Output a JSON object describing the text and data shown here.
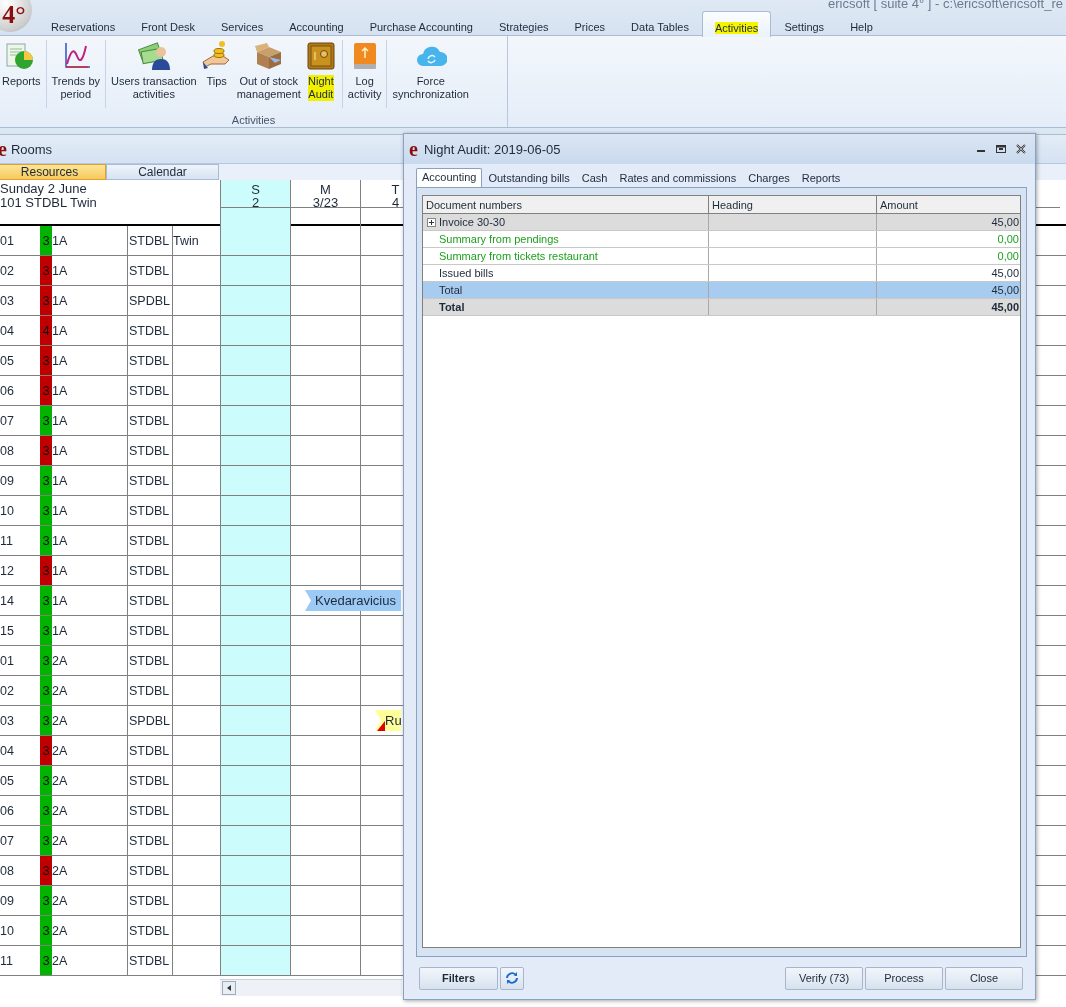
{
  "app": {
    "title": "ericsoft [ suite 4° ] - c:\\ericsoft\\ericsoft_re",
    "logo": "4°"
  },
  "menu": [
    {
      "label": "Reservations",
      "selected": false,
      "highlighted": false
    },
    {
      "label": "Front Desk",
      "selected": false,
      "highlighted": false
    },
    {
      "label": "Services",
      "selected": false,
      "highlighted": false
    },
    {
      "label": "Accounting",
      "selected": false,
      "highlighted": false
    },
    {
      "label": "Purchase Accounting",
      "selected": false,
      "highlighted": false
    },
    {
      "label": "Strategies",
      "selected": false,
      "highlighted": false
    },
    {
      "label": "Prices",
      "selected": false,
      "highlighted": false
    },
    {
      "label": "Data Tables",
      "selected": false,
      "highlighted": false
    },
    {
      "label": "Activities",
      "selected": true,
      "highlighted": true
    },
    {
      "label": "Settings",
      "selected": false,
      "highlighted": false
    },
    {
      "label": "Help",
      "selected": false,
      "highlighted": false
    }
  ],
  "ribbon": {
    "group_label": "Activities",
    "buttons": [
      {
        "label": "Reports",
        "highlighted": false
      },
      {
        "label": "Trends by\nperiod",
        "highlighted": false
      },
      {
        "label": "Users transaction\nactivities",
        "highlighted": false
      },
      {
        "label": "Tips",
        "highlighted": false
      },
      {
        "label": "Out of stock\nmanagement",
        "highlighted": false
      },
      {
        "label": "Night\nAudit",
        "highlighted": true
      },
      {
        "label": "Log\nactivity",
        "highlighted": false
      },
      {
        "label": "Force\nsynchronization",
        "highlighted": false
      }
    ]
  },
  "rooms": {
    "window_icon": "e",
    "title": "Rooms",
    "tabs": [
      {
        "label": "Resources",
        "selected": true
      },
      {
        "label": "Calendar",
        "selected": false
      }
    ],
    "header_lines": [
      "Sunday 2 June",
      "101 STDBL Twin"
    ],
    "days": [
      {
        "weekday": "S",
        "date": "2",
        "highlighted": true
      },
      {
        "weekday": "M",
        "date": "3/23",
        "highlighted": false
      },
      {
        "weekday": "T",
        "date": "4",
        "highlighted": false
      }
    ],
    "rows": [
      {
        "room": "01",
        "status": "3",
        "color": "#00b400",
        "floor": "1A",
        "type": "STDBL",
        "note": "Twin",
        "cells": [
          {
            "highlighted": true
          },
          {
            "highlighted": false
          },
          {
            "highlighted": false
          }
        ]
      },
      {
        "room": "02",
        "status": "3",
        "color": "#c00000",
        "floor": "1A",
        "type": "STDBL",
        "cells": [
          {
            "highlighted": true
          },
          {
            "highlighted": false
          },
          {
            "highlighted": false
          }
        ]
      },
      {
        "room": "03",
        "status": "3",
        "color": "#c00000",
        "floor": "1A",
        "type": "SPDBL",
        "cells": [
          {
            "highlighted": true
          },
          {
            "highlighted": false
          },
          {
            "highlighted": false
          }
        ]
      },
      {
        "room": "04",
        "status": "4",
        "color": "#c00000",
        "floor": "1A",
        "type": "STDBL",
        "cells": [
          {
            "highlighted": true
          },
          {
            "highlighted": false
          },
          {
            "highlighted": false
          }
        ]
      },
      {
        "room": "05",
        "status": "3",
        "color": "#c00000",
        "floor": "1A",
        "type": "STDBL",
        "cells": [
          {
            "highlighted": true
          },
          {
            "highlighted": false
          },
          {
            "highlighted": false
          }
        ]
      },
      {
        "room": "06",
        "status": "3",
        "color": "#c00000",
        "floor": "1A",
        "type": "STDBL",
        "cells": [
          {
            "highlighted": true
          },
          {
            "highlighted": false
          },
          {
            "highlighted": false
          }
        ]
      },
      {
        "room": "07",
        "status": "3",
        "color": "#00b400",
        "floor": "1A",
        "type": "STDBL",
        "cells": [
          {
            "highlighted": true
          },
          {
            "highlighted": false
          },
          {
            "highlighted": false
          }
        ]
      },
      {
        "room": "08",
        "status": "3",
        "color": "#c00000",
        "floor": "1A",
        "type": "STDBL",
        "cells": [
          {
            "highlighted": true
          },
          {
            "highlighted": false
          },
          {
            "highlighted": false
          }
        ]
      },
      {
        "room": "09",
        "status": "3",
        "color": "#00b400",
        "floor": "1A",
        "type": "STDBL",
        "cells": [
          {
            "highlighted": true
          },
          {
            "highlighted": false
          },
          {
            "highlighted": false
          }
        ]
      },
      {
        "room": "10",
        "status": "3",
        "color": "#00b400",
        "floor": "1A",
        "type": "STDBL",
        "cells": [
          {
            "highlighted": true
          },
          {
            "highlighted": false
          },
          {
            "highlighted": false
          }
        ]
      },
      {
        "room": "11",
        "status": "3",
        "color": "#00b400",
        "floor": "1A",
        "type": "STDBL",
        "cells": [
          {
            "highlighted": true
          },
          {
            "highlighted": false
          },
          {
            "highlighted": false
          }
        ]
      },
      {
        "room": "12",
        "status": "3",
        "color": "#c00000",
        "floor": "1A",
        "type": "STDBL",
        "cells": [
          {
            "highlighted": true
          },
          {
            "highlighted": false
          },
          {
            "highlighted": false
          }
        ]
      },
      {
        "room": "14",
        "status": "3",
        "color": "#00b400",
        "floor": "1A",
        "type": "STDBL",
        "cells": [
          {
            "highlighted": true
          },
          {
            "highlighted": false,
            "booking": {
              "name": "Kvedaravicius",
              "color": "#9ccaf5",
              "flagged": false
            }
          },
          {
            "highlighted": false
          }
        ]
      },
      {
        "room": "15",
        "status": "3",
        "color": "#00b400",
        "floor": "1A",
        "type": "STDBL",
        "cells": [
          {
            "highlighted": true
          },
          {
            "highlighted": false
          },
          {
            "highlighted": false
          }
        ]
      },
      {
        "room": "01",
        "status": "3",
        "color": "#00b400",
        "floor": "2A",
        "type": "STDBL",
        "cells": [
          {
            "highlighted": true
          },
          {
            "highlighted": false
          },
          {
            "highlighted": false
          }
        ]
      },
      {
        "room": "02",
        "status": "3",
        "color": "#00b400",
        "floor": "2A",
        "type": "STDBL",
        "cells": [
          {
            "highlighted": true
          },
          {
            "highlighted": false
          },
          {
            "highlighted": false
          }
        ]
      },
      {
        "room": "03",
        "status": "3",
        "color": "#00b400",
        "floor": "2A",
        "type": "SPDBL",
        "cells": [
          {
            "highlighted": true
          },
          {
            "highlighted": false
          },
          {
            "highlighted": false,
            "booking": {
              "name": "Ru",
              "color": "#ffff99",
              "flagged": true
            }
          }
        ]
      },
      {
        "room": "04",
        "status": "3",
        "color": "#c00000",
        "floor": "2A",
        "type": "STDBL",
        "cells": [
          {
            "highlighted": true
          },
          {
            "highlighted": false
          },
          {
            "highlighted": false
          }
        ]
      },
      {
        "room": "05",
        "status": "3",
        "color": "#00b400",
        "floor": "2A",
        "type": "STDBL",
        "cells": [
          {
            "highlighted": true
          },
          {
            "highlighted": false
          },
          {
            "highlighted": false
          }
        ]
      },
      {
        "room": "06",
        "status": "3",
        "color": "#00b400",
        "floor": "2A",
        "type": "STDBL",
        "cells": [
          {
            "highlighted": true
          },
          {
            "highlighted": false
          },
          {
            "highlighted": false
          }
        ]
      },
      {
        "room": "07",
        "status": "3",
        "color": "#00b400",
        "floor": "2A",
        "type": "STDBL",
        "cells": [
          {
            "highlighted": true
          },
          {
            "highlighted": false
          },
          {
            "highlighted": false
          }
        ]
      },
      {
        "room": "08",
        "status": "3",
        "color": "#c00000",
        "floor": "2A",
        "type": "STDBL",
        "cells": [
          {
            "highlighted": true
          },
          {
            "highlighted": false
          },
          {
            "highlighted": false
          }
        ]
      },
      {
        "room": "09",
        "status": "3",
        "color": "#00b400",
        "floor": "2A",
        "type": "STDBL",
        "cells": [
          {
            "highlighted": true
          },
          {
            "highlighted": false
          },
          {
            "highlighted": false
          }
        ]
      },
      {
        "room": "10",
        "status": "3",
        "color": "#00b400",
        "floor": "2A",
        "type": "STDBL",
        "cells": [
          {
            "highlighted": true
          },
          {
            "highlighted": false
          },
          {
            "highlighted": false
          }
        ]
      },
      {
        "room": "11",
        "status": "3",
        "color": "#00b400",
        "floor": "2A",
        "type": "STDBL",
        "cells": [
          {
            "highlighted": true
          },
          {
            "highlighted": false
          },
          {
            "highlighted": false
          }
        ]
      }
    ]
  },
  "dialog": {
    "window_icon": "e",
    "title": "Night Audit: 2019-06-05",
    "tabs": [
      {
        "label": "Accounting",
        "selected": true
      },
      {
        "label": "Outstanding bills",
        "selected": false
      },
      {
        "label": "Cash",
        "selected": false
      },
      {
        "label": "Rates and commissions",
        "selected": false
      },
      {
        "label": "Charges",
        "selected": false
      },
      {
        "label": "Reports",
        "selected": false
      }
    ],
    "table": {
      "columns": [
        "Document numbers",
        "Heading",
        "Amount"
      ],
      "rows": [
        {
          "kind": "group",
          "document": "Invoice 30-30",
          "amount": "45,00",
          "selected": false
        },
        {
          "kind": "summary",
          "document": "Summary from pendings",
          "amount": "0,00",
          "selected": false
        },
        {
          "kind": "summary",
          "document": "Summary from tickets restaurant",
          "amount": "0,00",
          "selected": false
        },
        {
          "kind": "normal",
          "document": "Issued bills",
          "amount": "45,00",
          "selected": false
        },
        {
          "kind": "normal",
          "document": "Total",
          "amount": "45,00",
          "selected": true
        },
        {
          "kind": "total",
          "document": "Total",
          "amount": "45,00",
          "selected": false
        }
      ]
    },
    "buttons": [
      {
        "label": "Filters",
        "kind": "bold"
      },
      {
        "kind": "refresh"
      },
      {
        "label": "Verify (73)",
        "kind": "normal"
      },
      {
        "label": "Process",
        "kind": "normal"
      },
      {
        "label": "Close",
        "kind": "normal"
      }
    ]
  }
}
